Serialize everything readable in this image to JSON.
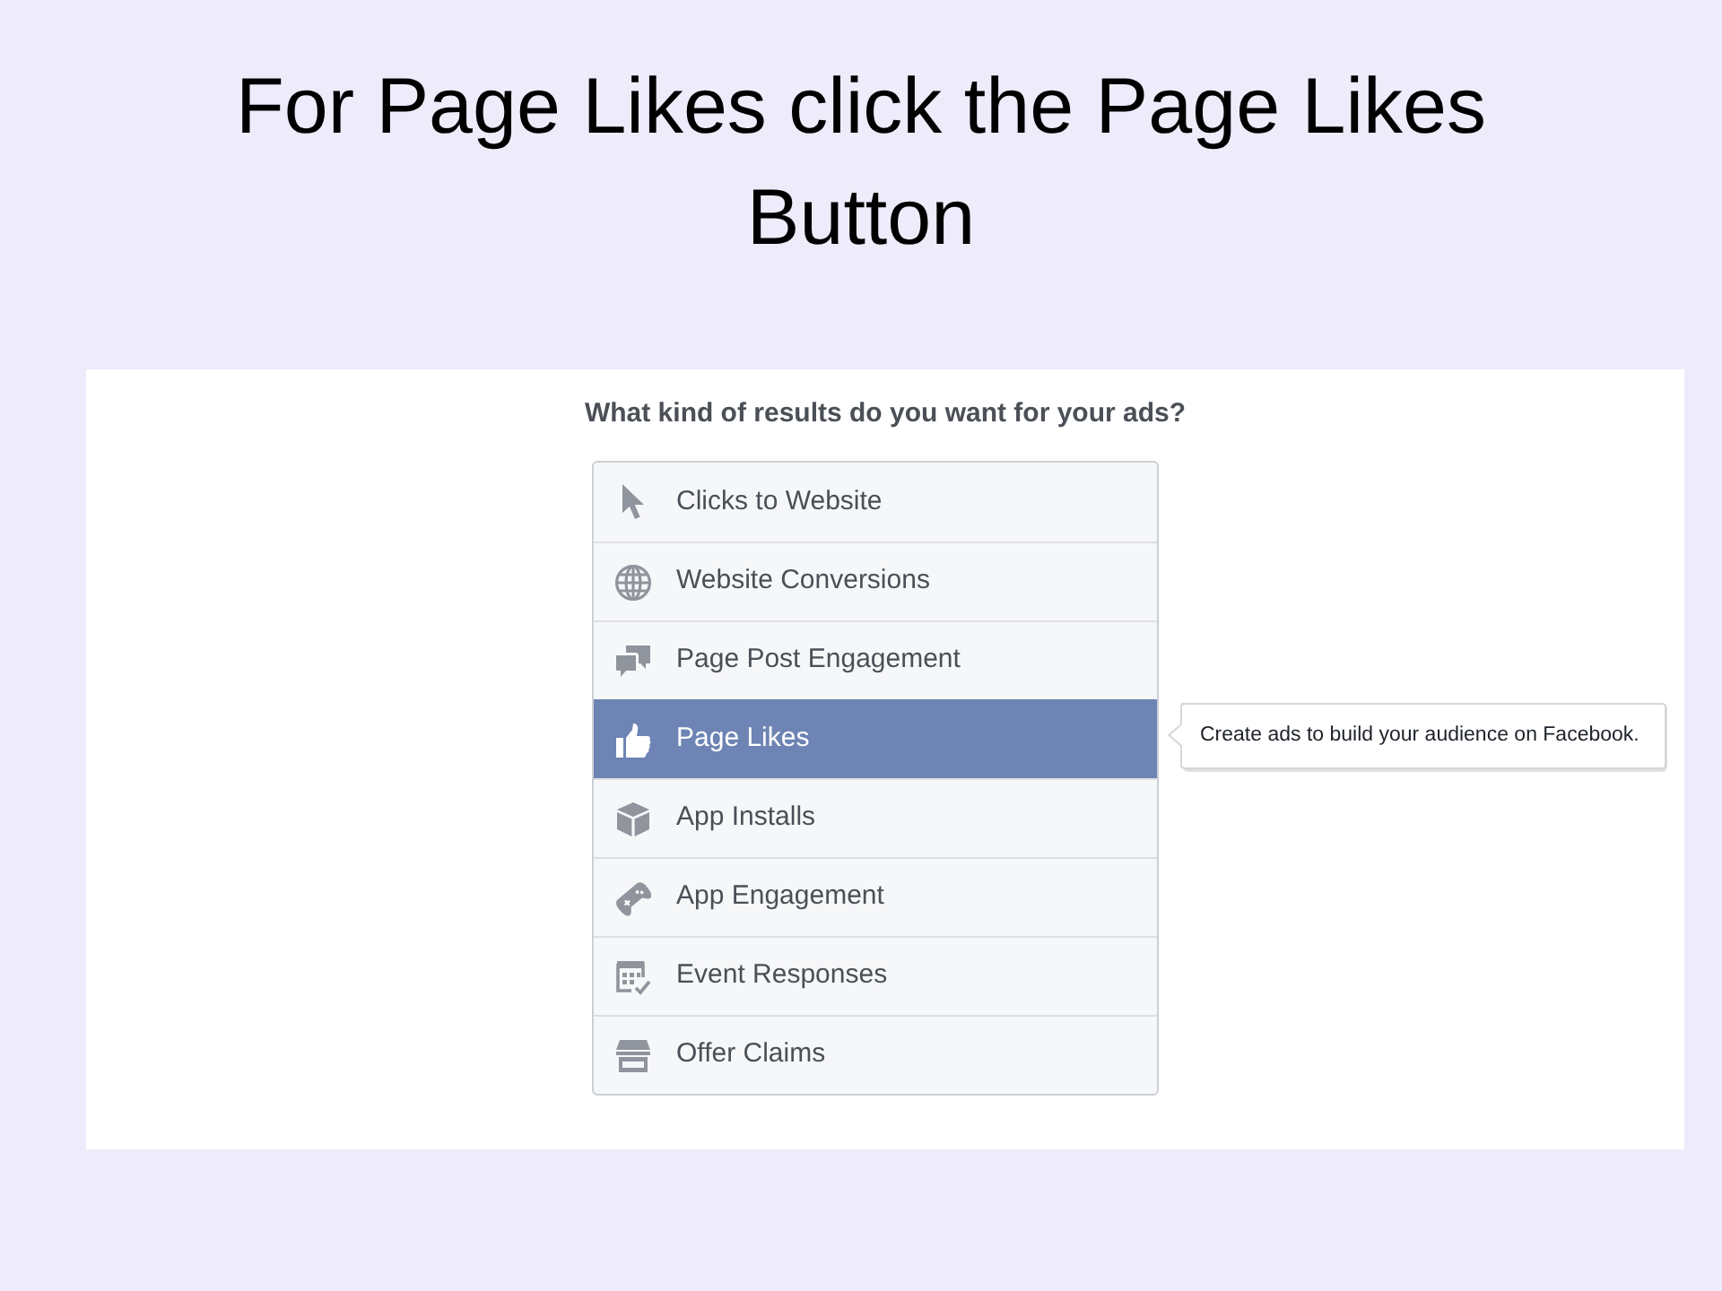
{
  "slide": {
    "title": "For Page Likes click the Page Likes Button"
  },
  "screenshot": {
    "question": "What kind of results do you want for your ads?",
    "options": [
      {
        "kind": "pointer",
        "label": "Clicks to Website",
        "selected": false
      },
      {
        "kind": "globe",
        "label": "Website Conversions",
        "selected": false
      },
      {
        "kind": "chat",
        "label": "Page Post Engagement",
        "selected": false
      },
      {
        "kind": "thumb",
        "label": "Page Likes",
        "selected": true
      },
      {
        "kind": "box",
        "label": "App Installs",
        "selected": false
      },
      {
        "kind": "gamepad",
        "label": "App Engagement",
        "selected": false
      },
      {
        "kind": "calendar",
        "label": "Event Responses",
        "selected": false
      },
      {
        "kind": "store",
        "label": "Offer Claims",
        "selected": false
      }
    ],
    "tooltip": "Create ads to build your audience on Facebook."
  }
}
